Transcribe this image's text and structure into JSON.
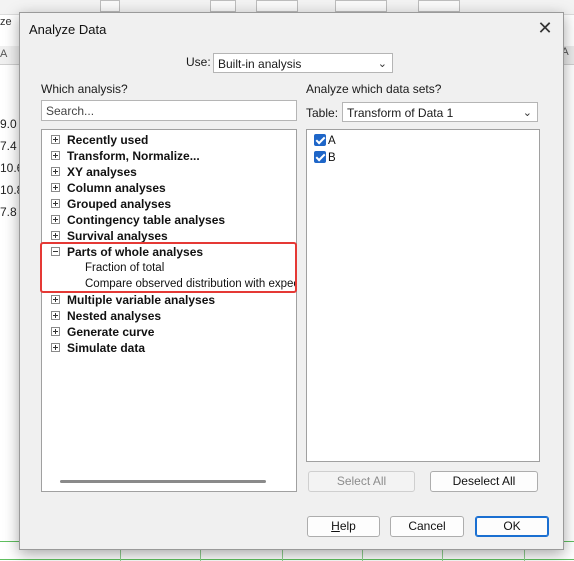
{
  "background": {
    "top_left_text": "ze",
    "column_letter": "A",
    "right_column_letter": "A",
    "cells": [
      "9.0",
      "7.4",
      "10.6",
      "10.8",
      "7.8"
    ]
  },
  "dialog": {
    "title": "Analyze Data",
    "use_label": "Use:",
    "use_value": "Built-in analysis",
    "which_analysis_label": "Which analysis?",
    "search_placeholder": "Search...",
    "tree": [
      {
        "label": "Recently used",
        "expanded": false
      },
      {
        "label": "Transform, Normalize...",
        "expanded": false
      },
      {
        "label": "XY analyses",
        "expanded": false
      },
      {
        "label": "Column analyses",
        "expanded": false
      },
      {
        "label": "Grouped analyses",
        "expanded": false
      },
      {
        "label": "Contingency table analyses",
        "expanded": false
      },
      {
        "label": "Survival analyses",
        "expanded": false
      },
      {
        "label": "Parts of whole analyses",
        "expanded": true,
        "children": [
          "Fraction of total",
          "Compare observed distribution with expected"
        ]
      },
      {
        "label": "Multiple variable analyses",
        "expanded": false
      },
      {
        "label": "Nested analyses",
        "expanded": false
      },
      {
        "label": "Generate curve",
        "expanded": false
      },
      {
        "label": "Simulate data",
        "expanded": false
      }
    ],
    "datasets_label": "Analyze which data sets?",
    "table_label": "Table:",
    "table_value": "Transform of Data 1",
    "datasets": [
      {
        "label": "A",
        "checked": true
      },
      {
        "label": "B",
        "checked": true
      }
    ],
    "select_all": "Select All",
    "deselect_all": "Deselect All",
    "help_prefix": "",
    "help_underlined": "H",
    "help_rest": "elp",
    "cancel": "Cancel",
    "ok": "OK",
    "highlight_color": "#e53935",
    "checkbox_color": "#1e66c8"
  }
}
